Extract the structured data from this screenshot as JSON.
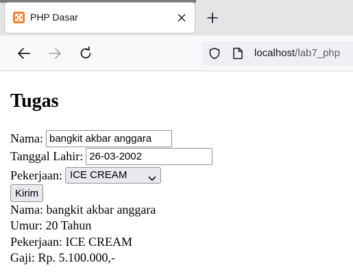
{
  "browser": {
    "tab_title": "PHP Dasar",
    "url_host": "localhost",
    "url_path": "/lab7_php",
    "icons": {
      "favicon": "xampp-icon",
      "close": "close-icon",
      "new_tab": "plus-icon",
      "back": "back-arrow-icon",
      "forward": "forward-arrow-icon",
      "reload": "reload-icon",
      "shield": "shield-icon",
      "page": "page-icon"
    }
  },
  "page": {
    "heading": "Tugas",
    "form": {
      "nama_label": "Nama:",
      "nama_value": "bangkit akbar anggara",
      "tanggal_label": "Tanggal Lahir:",
      "tanggal_value": "26-03-2002",
      "pekerjaan_label": "Pekerjaan:",
      "pekerjaan_selected": "ICE CREAM",
      "submit_label": "Kirim"
    },
    "result": {
      "nama": "Nama: bangkit akbar anggara",
      "umur": "Umur: 20 Tahun",
      "pekerjaan": "Pekerjaan: ICE CREAM",
      "gaji": "Gaji: Rp. 5.100.000,-"
    }
  },
  "colors": {
    "favicon_bg": "#fb7a24",
    "tabbar_bg": "#e5e5e8",
    "navbar_bg": "#f9f9fb"
  }
}
